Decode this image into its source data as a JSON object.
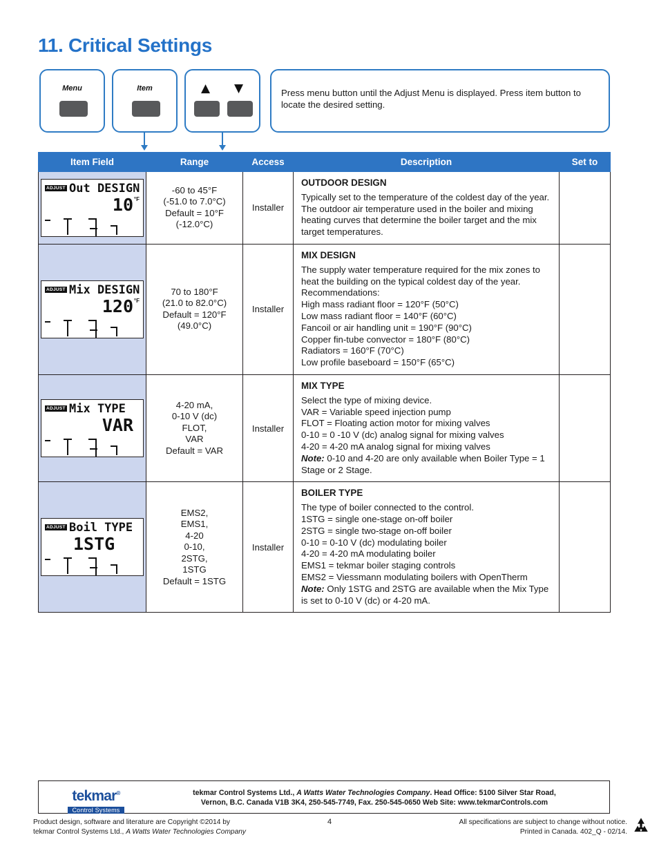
{
  "page": {
    "title": "11. Critical Settings",
    "number": "4"
  },
  "keys": {
    "menu_label": "Menu",
    "item_label": "Item",
    "up_glyph": "▲",
    "down_glyph": "▼",
    "instruction": "Press menu button until the Adjust Menu is displayed. Press item button to locate the desired setting."
  },
  "table": {
    "headers": {
      "item_field": "Item Field",
      "range": "Range",
      "access": "Access",
      "description": "Description",
      "set_to": "Set to"
    },
    "rows": [
      {
        "lcd": {
          "badge": "ADJUST",
          "top": "Out DESIGN",
          "value": "10",
          "unit": "°F"
        },
        "range": "-60 to 45°F\n(-51.0 to 7.0°C)\nDefault = 10°F\n(-12.0°C)",
        "access": "Installer",
        "desc_title": "OUTDOOR DESIGN",
        "desc_lines": [
          "Typically set to the temperature of the coldest day of the year. The outdoor air temperature used in the boiler and mixing heating curves that determine the boiler target and the mix target temperatures."
        ],
        "note_label": "",
        "note_text": "",
        "set_to": ""
      },
      {
        "lcd": {
          "badge": "ADJUST",
          "top": "Mix DESIGN",
          "value": "120",
          "unit": "°F"
        },
        "range": "70 to 180°F\n(21.0 to 82.0°C)\nDefault = 120°F\n(49.0°C)",
        "access": "Installer",
        "desc_title": "MIX DESIGN",
        "desc_lines": [
          "The supply water temperature required for the mix zones to heat the building on the typical coldest day of the year. Recommendations:",
          "High mass radiant floor = 120°F (50°C)",
          "Low mass radiant floor = 140°F (60°C)",
          "Fancoil or air handling unit = 190°F (90°C)",
          "Copper fin-tube convector = 180°F (80°C)",
          "Radiators = 160°F (70°C)",
          "Low profile baseboard = 150°F (65°C)"
        ],
        "note_label": "",
        "note_text": "",
        "set_to": ""
      },
      {
        "lcd": {
          "badge": "ADJUST",
          "top": "Mix TYPE",
          "value": "VAR",
          "unit": ""
        },
        "range": "4-20 mA,\n0-10 V (dc)\nFLOT,\nVAR\nDefault = VAR",
        "access": "Installer",
        "desc_title": "MIX TYPE",
        "desc_lines": [
          "Select the type of mixing device.",
          "VAR = Variable speed injection pump",
          "FLOT = Floating action motor for mixing valves",
          "0-10 = 0 -10 V (dc) analog signal for mixing valves",
          "4-20 = 4-20 mA analog signal for mixing valves"
        ],
        "note_label": "Note:",
        "note_text": " 0-10 and 4-20 are only available when Boiler Type = 1 Stage or 2 Stage.",
        "set_to": ""
      },
      {
        "lcd": {
          "badge": "ADJUST",
          "top": "Boil TYPE",
          "value": "1STG",
          "unit": ""
        },
        "range": "EMS2,\nEMS1,\n4-20\n0-10,\n2STG,\n1STG\nDefault = 1STG",
        "access": "Installer",
        "desc_title": "BOILER TYPE",
        "desc_lines": [
          "The type of boiler connected to the control.",
          "1STG = single one-stage on-off boiler",
          "2STG = single two-stage on-off boiler",
          "0-10 = 0-10 V (dc) modulating boiler",
          "4-20 = 4-20 mA modulating boiler",
          "EMS1 = tekmar boiler staging controls",
          "EMS2 = Viessmann modulating boilers with OpenTherm"
        ],
        "note_label": "Note:",
        "note_text": " Only 1STG and 2STG are available when the Mix Type is set to 0-10 V (dc) or 4-20 mA.",
        "set_to": ""
      }
    ]
  },
  "footer": {
    "logo_main": "tekmar",
    "logo_reg": "®",
    "logo_sub": "Control Systems",
    "company_pre": "tekmar Control Systems Ltd., ",
    "company_ital": "A Watts Water Technologies Company",
    "company_post": ". Head Office: 5100 Silver Star Road,",
    "address_line2": "Vernon, B.C. Canada V1B 3K4, 250-545-7749, Fax. 250-545-0650 Web Site: www.tekmarControls.com",
    "legal_left_1": "Product design, software and literature are Copyright ©2014 by",
    "legal_left_2a": "tekmar Control Systems Ltd., ",
    "legal_left_2b": "A Watts Water Technologies Company",
    "legal_right_1": "All specifications are subject to change without notice.",
    "legal_right_2": "Printed in Canada. 402_Q - 02/14."
  },
  "colors": {
    "brand_blue": "#2e75c4",
    "title_blue": "#2472c8",
    "item_cell_bg": "#ccd6ee",
    "logo_blue": "#1c4f9c"
  }
}
